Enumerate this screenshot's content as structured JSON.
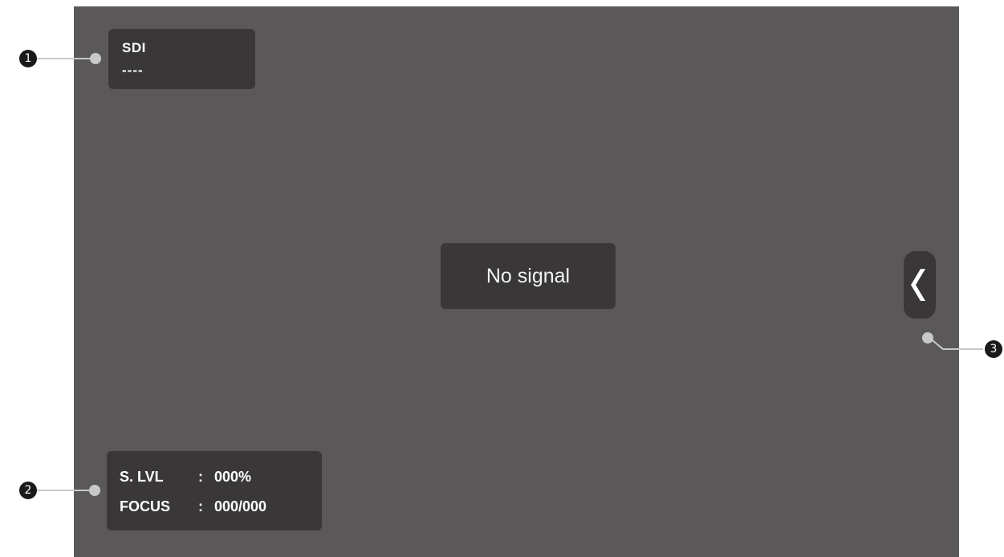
{
  "input": {
    "name": "SDI",
    "format": "----"
  },
  "center_message": "No signal",
  "status": {
    "slvl_label": "S. LVL",
    "slvl_value": "000%",
    "focus_label": "FOCUS",
    "focus_value": "000/000",
    "separator": ":"
  },
  "menu_tab": {
    "icon": "chevron-left-icon"
  },
  "callouts": [
    "1",
    "2",
    "3"
  ],
  "colors": {
    "screen_bg": "#5a5859",
    "panel_bg": "#3a3738",
    "callout_line": "#c8c8c8",
    "callout_badge": "#1a1a1a"
  }
}
